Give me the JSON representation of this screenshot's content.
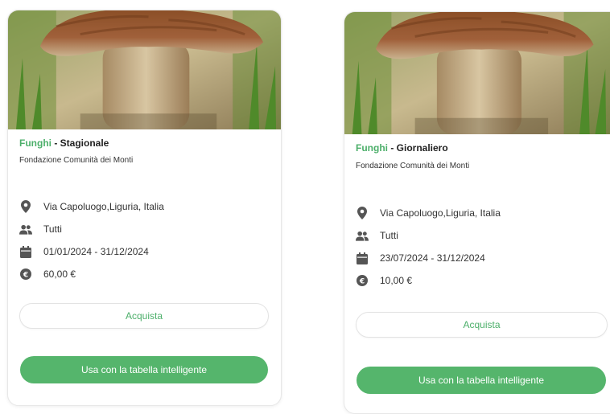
{
  "cards": [
    {
      "category": "Funghi",
      "separator": " - ",
      "type": "Stagionale",
      "organization": "Fondazione Comunità dei Monti",
      "location": "Via Capoluogo,Liguria, Italia",
      "audience": "Tutti",
      "dates": "01/01/2024 - 31/12/2024",
      "price": "60,00 €",
      "buy_label": "Acquista",
      "smart_table_label": "Usa con la tabella intelligente",
      "icons": [
        "location-pin-icon",
        "people-icon",
        "calendar-icon",
        "euro-icon"
      ]
    },
    {
      "category": "Funghi",
      "separator": " - ",
      "type": "Giornaliero",
      "organization": "Fondazione Comunità dei Monti",
      "location": "Via Capoluogo,Liguria, Italia",
      "audience": "Tutti",
      "dates": "23/07/2024 - 31/12/2024",
      "price": "10,00 €",
      "buy_label": "Acquista",
      "smart_table_label": "Usa con la tabella intelligente",
      "icons": [
        "location-pin-icon",
        "people-icon",
        "calendar-icon",
        "euro-icon"
      ]
    }
  ],
  "colors": {
    "accent_green": "#4caf6a",
    "button_green": "#55b56c",
    "icon_dark": "#555555"
  }
}
